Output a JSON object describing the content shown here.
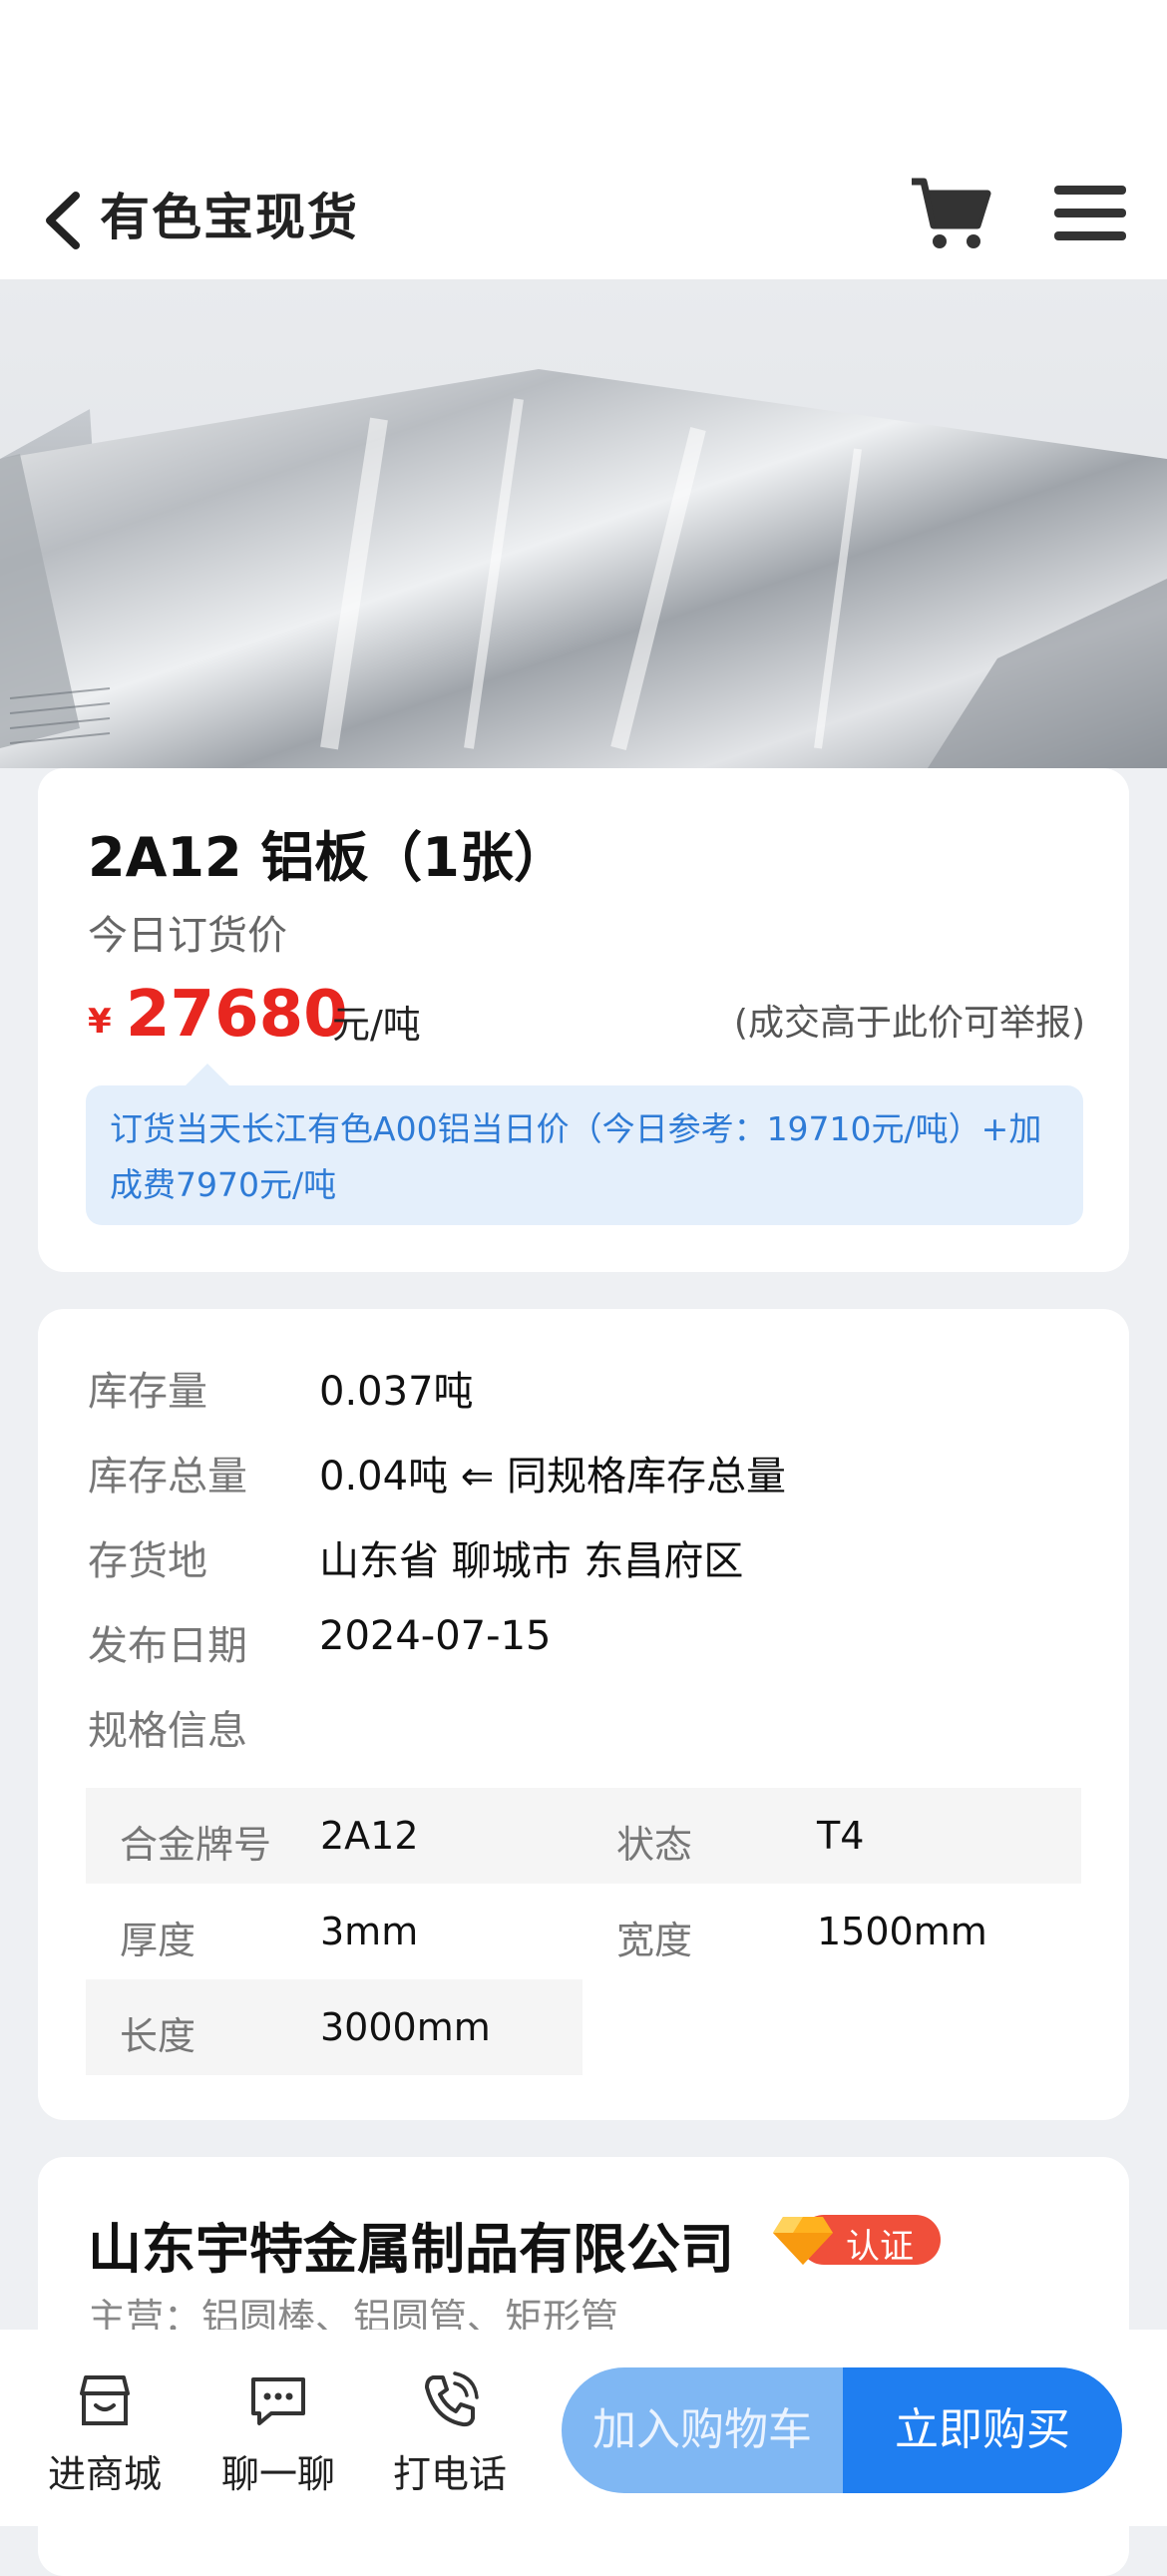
{
  "nav": {
    "title": "有色宝现货"
  },
  "product": {
    "title": "2A12 铝板（1张）",
    "price_label": "今日订货价",
    "currency_symbol": "¥",
    "price": "27680",
    "unit": "元/吨",
    "report_note": "(成交高于此价可举报)",
    "pricing_note": "订货当天长江有色A00铝当日价（今日参考：19710元/吨）+加成费7970元/吨"
  },
  "details": {
    "stock_label": "库存量",
    "stock_value": "0.037吨",
    "total_label": "库存总量",
    "total_value": "0.04吨 ⇐ 同规格库存总量",
    "location_label": "存货地",
    "location_value": "山东省 聊城市 东昌府区",
    "date_label": "发布日期",
    "date_value": "2024-07-15",
    "spec_label": "规格信息",
    "specs": [
      {
        "key": "合金牌号",
        "value": "2A12"
      },
      {
        "key": "状态",
        "value": "T4"
      },
      {
        "key": "厚度",
        "value": "3mm"
      },
      {
        "key": "宽度",
        "value": "1500mm"
      },
      {
        "key": "长度",
        "value": "3000mm"
      }
    ]
  },
  "seller": {
    "name": "山东宇特金属制品有限公司",
    "badge": "认证",
    "main_business": "主营：铝圆棒、铝圆管、矩形管"
  },
  "bottom_bar": {
    "store": "进商城",
    "chat": "聊一聊",
    "call": "打电话",
    "add_cart": "加入购物车",
    "buy_now": "立即购买"
  },
  "colors": {
    "accent": "#1f7ef0",
    "price": "#e8261f",
    "badge": "#f04f3a"
  }
}
